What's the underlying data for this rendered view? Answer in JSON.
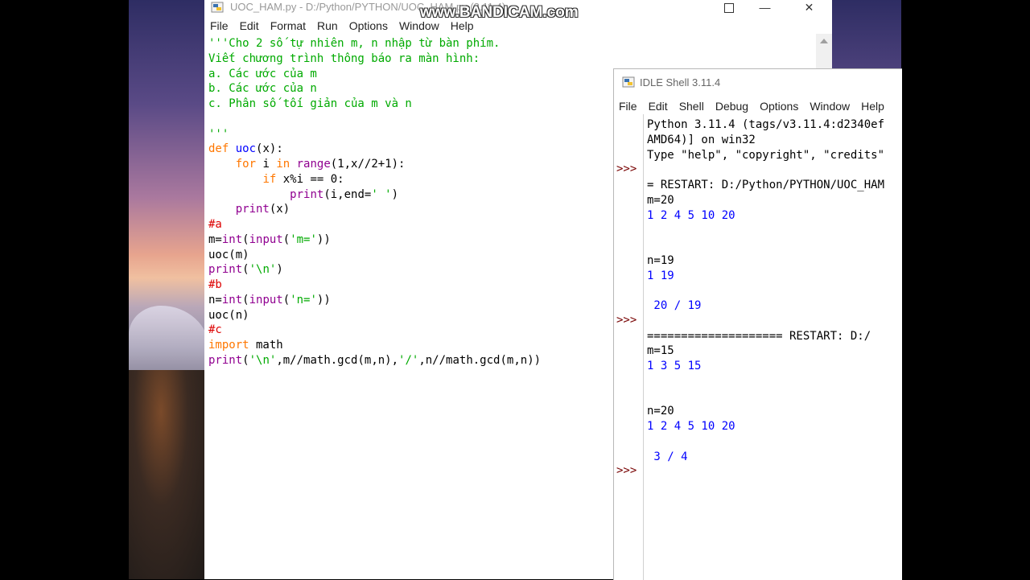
{
  "editor": {
    "title": "UOC_HAM.py - D:/Python/PYTHON/UOC_HAM.py (3.11.4)",
    "menu": [
      "File",
      "Edit",
      "Format",
      "Run",
      "Options",
      "Window",
      "Help"
    ],
    "code_lines": [
      [
        {
          "t": "'''Cho 2 số tự nhiên m, n nhập từ bàn phím.",
          "c": "st"
        }
      ],
      [
        {
          "t": "Viết chương trình thông báo ra màn hình:",
          "c": "st"
        }
      ],
      [
        {
          "t": "a. Các ước của m",
          "c": "st"
        }
      ],
      [
        {
          "t": "b. Các ước của n",
          "c": "st"
        }
      ],
      [
        {
          "t": "c. Phân số tối giản của m và n",
          "c": "st"
        }
      ],
      [
        {
          "t": "",
          "c": ""
        }
      ],
      [
        {
          "t": "'''",
          "c": "st"
        }
      ],
      [
        {
          "t": "def",
          "c": "kw"
        },
        {
          "t": " ",
          "c": ""
        },
        {
          "t": "uoc",
          "c": "df"
        },
        {
          "t": "(x):",
          "c": ""
        }
      ],
      [
        {
          "t": "    ",
          "c": ""
        },
        {
          "t": "for",
          "c": "kw"
        },
        {
          "t": " i ",
          "c": ""
        },
        {
          "t": "in",
          "c": "kw"
        },
        {
          "t": " ",
          "c": ""
        },
        {
          "t": "range",
          "c": "bi"
        },
        {
          "t": "(1,x//2+1):",
          "c": ""
        }
      ],
      [
        {
          "t": "        ",
          "c": ""
        },
        {
          "t": "if",
          "c": "kw"
        },
        {
          "t": " x%i == 0:",
          "c": ""
        }
      ],
      [
        {
          "t": "            ",
          "c": ""
        },
        {
          "t": "print",
          "c": "bi"
        },
        {
          "t": "(i,end=",
          "c": ""
        },
        {
          "t": "' '",
          "c": "st"
        },
        {
          "t": ")",
          "c": ""
        }
      ],
      [
        {
          "t": "    ",
          "c": ""
        },
        {
          "t": "print",
          "c": "bi"
        },
        {
          "t": "(x)",
          "c": ""
        }
      ],
      [
        {
          "t": "#a",
          "c": "cm"
        }
      ],
      [
        {
          "t": "m=",
          "c": ""
        },
        {
          "t": "int",
          "c": "bi"
        },
        {
          "t": "(",
          "c": ""
        },
        {
          "t": "input",
          "c": "bi"
        },
        {
          "t": "(",
          "c": ""
        },
        {
          "t": "'m='",
          "c": "st"
        },
        {
          "t": "))",
          "c": ""
        }
      ],
      [
        {
          "t": "uoc(m)",
          "c": ""
        }
      ],
      [
        {
          "t": "print",
          "c": "bi"
        },
        {
          "t": "(",
          "c": ""
        },
        {
          "t": "'\\n'",
          "c": "st"
        },
        {
          "t": ")",
          "c": ""
        }
      ],
      [
        {
          "t": "#b",
          "c": "cm"
        }
      ],
      [
        {
          "t": "n=",
          "c": ""
        },
        {
          "t": "int",
          "c": "bi"
        },
        {
          "t": "(",
          "c": ""
        },
        {
          "t": "input",
          "c": "bi"
        },
        {
          "t": "(",
          "c": ""
        },
        {
          "t": "'n='",
          "c": "st"
        },
        {
          "t": "))",
          "c": ""
        }
      ],
      [
        {
          "t": "uoc(n)",
          "c": ""
        }
      ],
      [
        {
          "t": "#c",
          "c": "cm"
        }
      ],
      [
        {
          "t": "import",
          "c": "kw"
        },
        {
          "t": " math",
          "c": ""
        }
      ],
      [
        {
          "t": "print",
          "c": "bi"
        },
        {
          "t": "(",
          "c": ""
        },
        {
          "t": "'\\n'",
          "c": "st"
        },
        {
          "t": ",m//math.gcd(m,n),",
          "c": ""
        },
        {
          "t": "'/'",
          "c": "st"
        },
        {
          "t": ",n//math.gcd(m,n))",
          "c": ""
        }
      ]
    ]
  },
  "watermark": "www.BANDICAM.com",
  "shell": {
    "title": "IDLE Shell 3.11.4",
    "menu": [
      "File",
      "Edit",
      "Shell",
      "Debug",
      "Options",
      "Window",
      "Help"
    ],
    "prompt": ">>>",
    "prompt_rows": [
      3,
      13,
      23
    ],
    "lines": [
      {
        "t": "Python 3.11.4 (tags/v3.11.4:d2340ef",
        "c": "sys"
      },
      {
        "t": "AMD64)] on win32",
        "c": "sys"
      },
      {
        "t": "Type \"help\", \"copyright\", \"credits\"",
        "c": "sys"
      },
      {
        "t": "",
        "c": "sys"
      },
      {
        "t": "= RESTART: D:/Python/PYTHON/UOC_HAM",
        "c": "sys"
      },
      {
        "t": "m=20",
        "c": "sys"
      },
      {
        "t": "1 2 4 5 10 20",
        "c": "out"
      },
      {
        "t": "",
        "c": "out"
      },
      {
        "t": "",
        "c": "out"
      },
      {
        "t": "n=19",
        "c": "sys"
      },
      {
        "t": "1 19",
        "c": "out"
      },
      {
        "t": "",
        "c": "out"
      },
      {
        "t": " 20 / 19",
        "c": "out"
      },
      {
        "t": "",
        "c": "out"
      },
      {
        "t": "==================== RESTART: D:/",
        "c": "sys"
      },
      {
        "t": "m=15",
        "c": "sys"
      },
      {
        "t": "1 3 5 15",
        "c": "out"
      },
      {
        "t": "",
        "c": "out"
      },
      {
        "t": "",
        "c": "out"
      },
      {
        "t": "n=20",
        "c": "sys"
      },
      {
        "t": "1 2 4 5 10 20",
        "c": "out"
      },
      {
        "t": "",
        "c": "out"
      },
      {
        "t": " 3 / 4",
        "c": "out"
      }
    ]
  },
  "colors": {
    "keyword": "#ff7700",
    "definition": "#0000ff",
    "builtin": "#900090",
    "string": "#00aa00",
    "comment": "#dd0000",
    "shell_output": "#0000ff",
    "shell_prompt": "#770000"
  }
}
